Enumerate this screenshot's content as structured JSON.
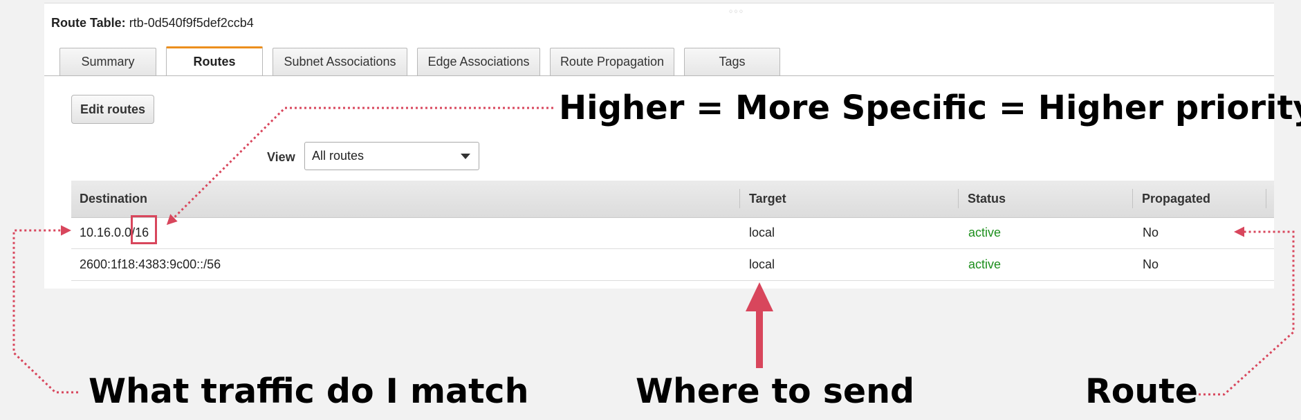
{
  "route_table": {
    "label": "Route Table:",
    "id": "rtb-0d540f9f5def2ccb4"
  },
  "tabs": [
    {
      "label": "Summary",
      "active": false
    },
    {
      "label": "Routes",
      "active": true
    },
    {
      "label": "Subnet Associations",
      "active": false
    },
    {
      "label": "Edge Associations",
      "active": false
    },
    {
      "label": "Route Propagation",
      "active": false
    },
    {
      "label": "Tags",
      "active": false
    }
  ],
  "toolbar": {
    "edit_label": "Edit routes"
  },
  "view": {
    "label": "View",
    "selected": "All routes"
  },
  "table": {
    "headers": [
      "Destination",
      "Target",
      "Status",
      "Propagated"
    ],
    "rows": [
      {
        "destination": "10.16.0.0/16",
        "target": "local",
        "status": "active",
        "propagated": "No"
      },
      {
        "destination": "2600:1f18:4383:9c00::/56",
        "target": "local",
        "status": "active",
        "propagated": "No"
      }
    ]
  },
  "annotations": {
    "priority": "Higher = More Specific = Higher priority",
    "match": "What traffic do I match",
    "send": "Where to send",
    "route": "Route"
  },
  "colors": {
    "accent_tab": "#ec8f1d",
    "annotation": "#d8465c",
    "status_active": "#1d8f1d"
  }
}
